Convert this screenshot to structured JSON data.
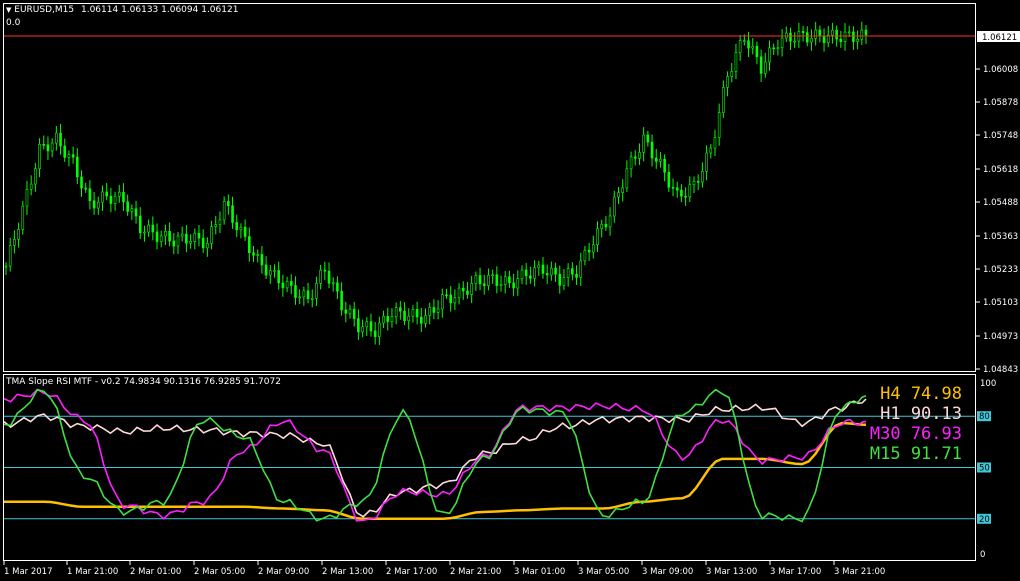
{
  "header": {
    "symbol": "EURUSD,M15",
    "ohlc": "1.06114 1.06133 1.06094 1.06121",
    "sub": "0.0"
  },
  "indicator": {
    "title": "TMA Slope RSI MTF - v0.2 74.9834 90.1316 76.9285 91.7072"
  },
  "legend": [
    {
      "tf": "H4",
      "value": "74.98",
      "color": "#ffc000"
    },
    {
      "tf": "H1",
      "value": "90.13",
      "color": "#ffdada"
    },
    {
      "tf": "M30",
      "value": "76.93",
      "color": "#ff20ff"
    },
    {
      "tf": "M15",
      "value": "91.71",
      "color": "#40e040"
    }
  ],
  "price_axis": [
    "1.06121",
    "1.06008",
    "1.05878",
    "1.05748",
    "1.05618",
    "1.05488",
    "1.05363",
    "1.05233",
    "1.05103",
    "1.04973",
    "1.04843"
  ],
  "current_price": "1.06121",
  "rsi_axis": [
    "100",
    "80",
    "50",
    "20",
    "0"
  ],
  "time_axis": [
    "1 Mar 2017",
    "1 Mar 21:00",
    "2 Mar 01:00",
    "2 Mar 05:00",
    "2 Mar 09:00",
    "2 Mar 13:00",
    "2 Mar 17:00",
    "2 Mar 21:00",
    "3 Mar 01:00",
    "3 Mar 05:00",
    "3 Mar 09:00",
    "3 Mar 13:00",
    "3 Mar 17:00",
    "3 Mar 21:00"
  ],
  "colors": {
    "candle": "#00ff00",
    "price_line": "#ff3030",
    "level": "#40c8d8",
    "grid": "#ffffff"
  },
  "chart_data": {
    "type": "line",
    "price": {
      "x_index": [
        0,
        4,
        8,
        12,
        16,
        20,
        24,
        28,
        32,
        36,
        40,
        44,
        48,
        52,
        56,
        60,
        64,
        68,
        72,
        76,
        80,
        84,
        88,
        92,
        96,
        100,
        104,
        108,
        112,
        116,
        120,
        124,
        128,
        132,
        136,
        140,
        144,
        148,
        152,
        156,
        160,
        164,
        168,
        172,
        176,
        180,
        184,
        188,
        192,
        196,
        200,
        204,
        208,
        212,
        216
      ],
      "close": [
        1.0523,
        1.0545,
        1.0568,
        1.0572,
        1.0563,
        1.0547,
        1.055,
        1.0549,
        1.0538,
        1.0535,
        1.0533,
        1.0534,
        1.0532,
        1.0547,
        1.0536,
        1.0525,
        1.0519,
        1.0514,
        1.051,
        1.0522,
        1.0508,
        1.05,
        1.0498,
        1.0505,
        1.0504,
        1.0503,
        1.051,
        1.0512,
        1.0517,
        1.0518,
        1.0516,
        1.052,
        1.0522,
        1.0518,
        1.0521,
        1.0533,
        1.0543,
        1.056,
        1.0572,
        1.0562,
        1.055,
        1.0554,
        1.0568,
        1.0597,
        1.0612,
        1.06,
        1.061,
        1.0612,
        1.0612,
        1.0612,
        1.0612,
        1.0612,
        1.0612,
        1.0612,
        1.0612
      ]
    },
    "rsi": {
      "ylim": [
        0,
        100
      ],
      "levels": [
        20,
        50,
        80
      ],
      "x": [
        0,
        10,
        20,
        30,
        40,
        50,
        60,
        70,
        80,
        90,
        100,
        110,
        120,
        130,
        140,
        150,
        160,
        170,
        180,
        190,
        200,
        210,
        216
      ],
      "series": [
        {
          "name": "H4",
          "color": "#ffc000",
          "values": [
            30,
            30,
            27,
            27,
            27,
            27,
            27,
            26,
            25,
            20,
            20,
            20,
            24,
            25,
            26,
            26,
            30,
            32,
            55,
            55,
            52,
            76,
            75
          ]
        },
        {
          "name": "H1",
          "color": "#ffdada",
          "values": [
            75,
            80,
            74,
            71,
            73,
            72,
            70,
            69,
            64,
            22,
            36,
            40,
            58,
            66,
            74,
            78,
            79,
            78,
            84,
            85,
            76,
            85,
            90
          ]
        },
        {
          "name": "M30",
          "color": "#ff20ff",
          "values": [
            90,
            94,
            78,
            28,
            22,
            30,
            60,
            77,
            60,
            18,
            36,
            34,
            56,
            85,
            85,
            86,
            84,
            56,
            78,
            54,
            56,
            76,
            77
          ]
        },
        {
          "name": "M15",
          "color": "#40e040",
          "values": [
            75,
            95,
            45,
            24,
            30,
            78,
            68,
            30,
            20,
            30,
            82,
            22,
            55,
            84,
            82,
            22,
            30,
            82,
            95,
            22,
            20,
            85,
            92
          ]
        }
      ]
    }
  }
}
